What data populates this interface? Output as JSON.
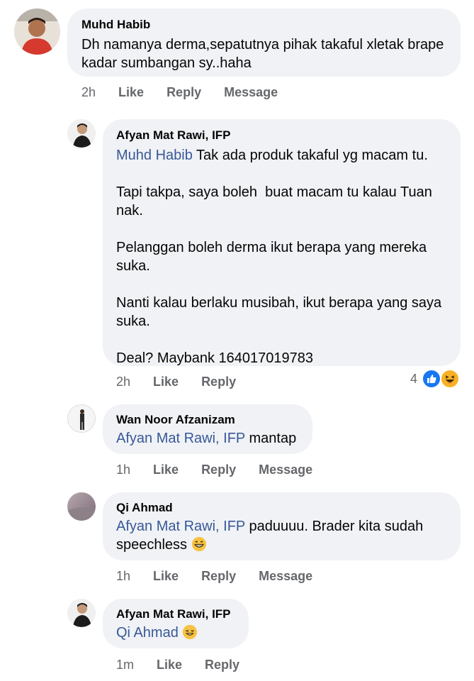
{
  "comments": [
    {
      "author": "Muhd Habib",
      "body": "Dh namanya derma,sepatutnya pihak takaful xletak brape\nkadar sumbangan sy..haha",
      "time": "2h",
      "like_label": "Like",
      "reply_label": "Reply",
      "message_label": "Message"
    },
    {
      "author": "Afyan Mat Rawi, IFP",
      "mention": "Muhd Habib",
      "body": " Tak ada produk takaful yg macam tu.\n\nTapi takpa, saya boleh  buat macam tu kalau Tuan\nnak.\n\nPelanggan boleh derma ikut berapa yang mereka\nsuka.\n\nNanti kalau berlaku musibah, ikut berapa yang saya\nsuka.\n\nDeal? Maybank 164017019783",
      "time": "2h",
      "like_label": "Like",
      "reply_label": "Reply",
      "reaction_count": "4",
      "reactions": [
        "like-icon",
        "haha-icon"
      ]
    },
    {
      "author": "Wan Noor Afzanizam",
      "mention": "Afyan Mat Rawi, IFP",
      "body": " mantap",
      "time": "1h",
      "like_label": "Like",
      "reply_label": "Reply",
      "message_label": "Message"
    },
    {
      "author": "Qi Ahmad",
      "mention": "Afyan Mat Rawi, IFP",
      "body": " paduuuu. Brader kita sudah\nspeechless",
      "emoji": "grinning-emoji",
      "time": "1h",
      "like_label": "Like",
      "reply_label": "Reply",
      "message_label": "Message"
    },
    {
      "author": "Afyan Mat Rawi, IFP",
      "mention": "Qi Ahmad",
      "body": " ",
      "emoji": "relieved-emoji",
      "time": "1m",
      "like_label": "Like",
      "reply_label": "Reply"
    }
  ],
  "colors": {
    "bubble": "#f0f2f5",
    "mention": "#385898",
    "meta": "#65676b",
    "like_blue": "#1877f2",
    "haha_yellow": "#f7b125"
  }
}
